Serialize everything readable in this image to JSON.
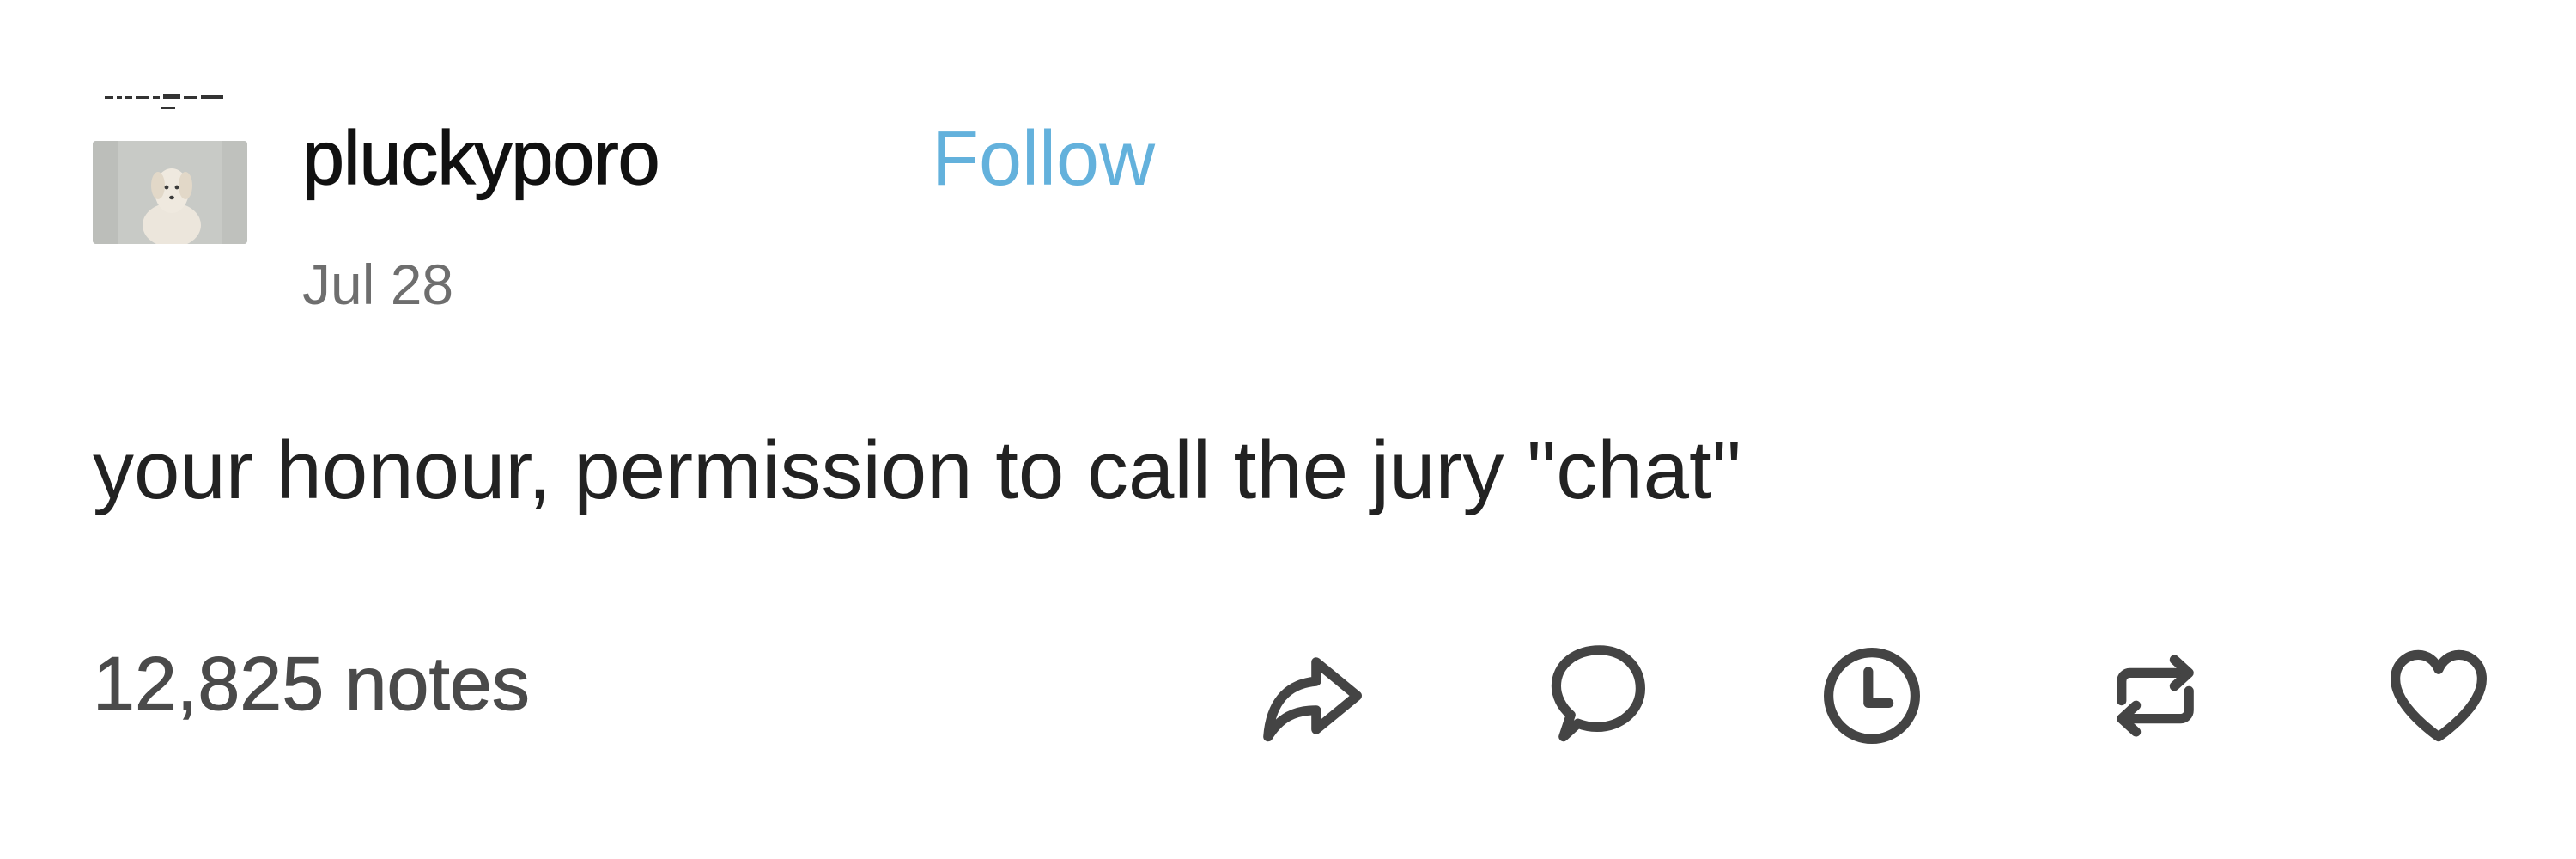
{
  "post": {
    "author": {
      "username": "pluckyporo",
      "avatar_icon": "dog-photo-avatar"
    },
    "follow_label": "Follow",
    "date": "Jul 28",
    "text": "your honour, permission to call the jury \"chat\"",
    "notes": "12,825 notes",
    "actions": [
      {
        "name": "share-icon"
      },
      {
        "name": "reply-icon"
      },
      {
        "name": "schedule-icon"
      },
      {
        "name": "reblog-icon"
      },
      {
        "name": "like-icon"
      }
    ]
  },
  "colors": {
    "follow": "#63b1dc",
    "username": "#111111",
    "date": "#6e6e6e",
    "text": "#222222",
    "notes": "#4a4a4a",
    "icons": "#444444"
  }
}
